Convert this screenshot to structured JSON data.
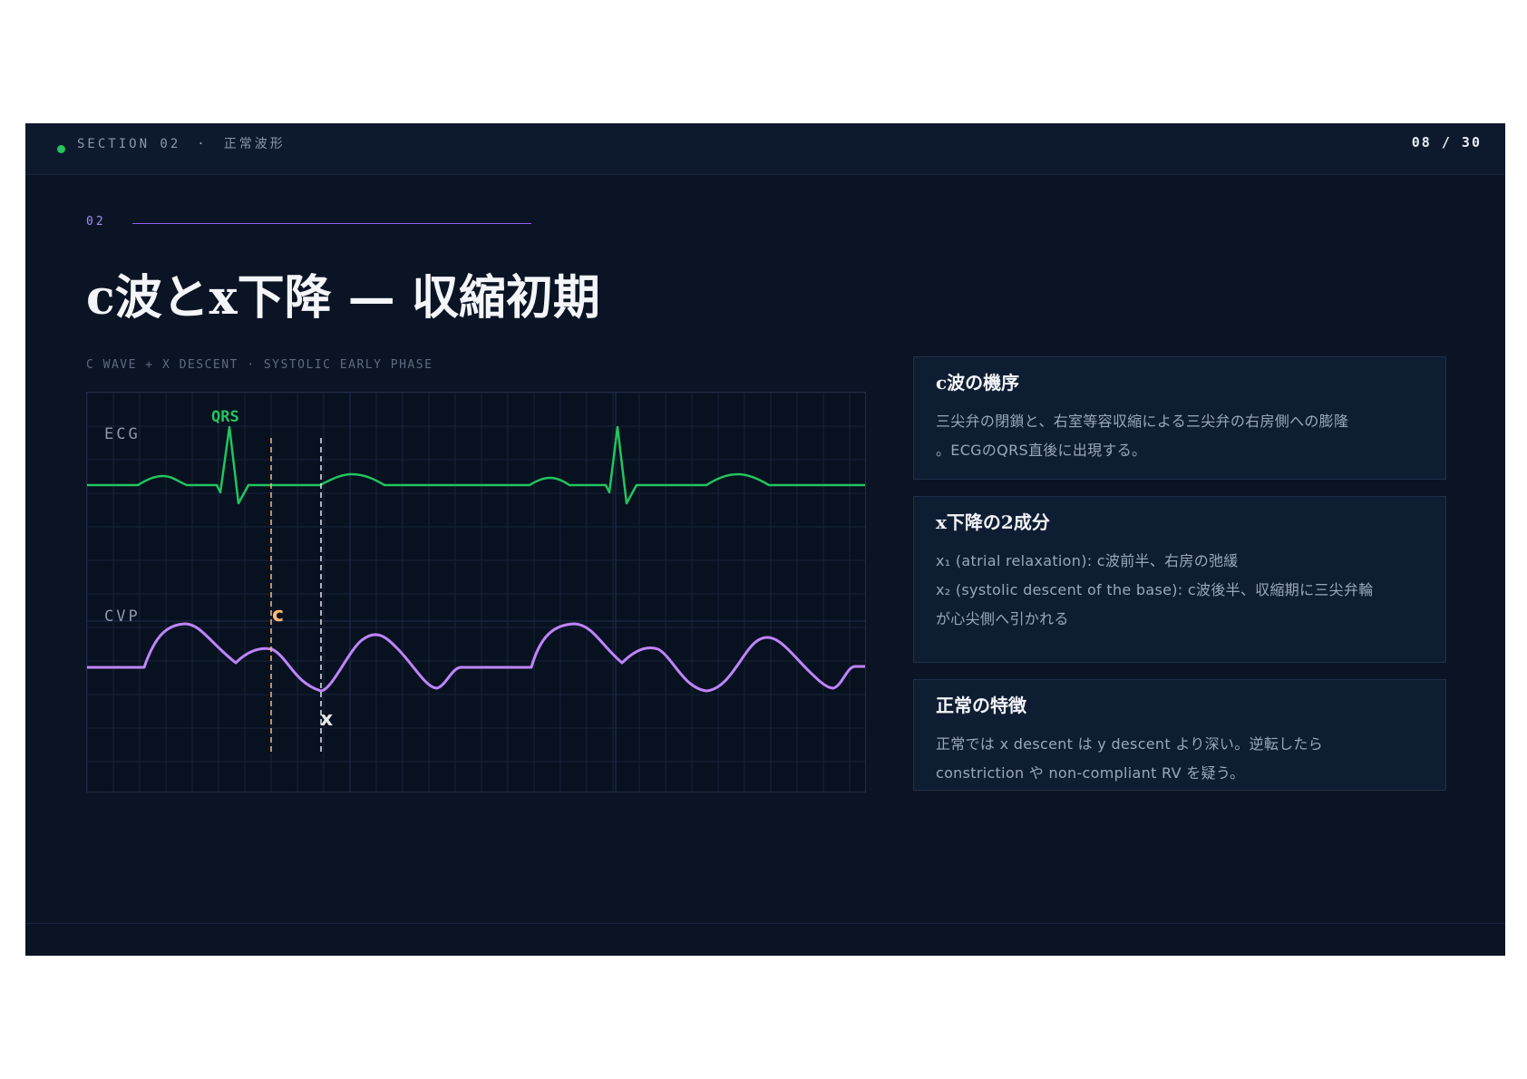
{
  "header": {
    "section": "SECTION 02",
    "separator": "·",
    "section_jp": "正常波形",
    "page": "08 / 30"
  },
  "eyebrow": {
    "number": "02"
  },
  "title": "c波とx下降 — 収縮初期",
  "subtitle": "C WAVE + X DESCENT  ·  SYSTOLIC EARLY PHASE",
  "diagram": {
    "ecg_label": "ECG",
    "cvp_label": "CVP",
    "qrs_label": "QRS",
    "c_label": "c",
    "x_label": "x",
    "colors": {
      "ecg": "#22c55e",
      "cvp": "#c084fc",
      "c_marker": "#fdba74",
      "x_marker": "#e5e7eb",
      "grid": "#16223a"
    }
  },
  "cards": [
    {
      "title": "c波の機序",
      "lines": [
        "三尖弁の閉鎖と、右室等容収縮による三尖弁の右房側への膨隆",
        "。ECGのQRS直後に出現する。"
      ]
    },
    {
      "title": "x下降の2成分",
      "lines": [
        "x₁ (atrial relaxation): c波前半、右房の弛緩",
        "x₂ (systolic descent of the base): c波後半、収縮期に三尖弁輪",
        "が心尖側へ引かれる"
      ]
    },
    {
      "title": "正常の特徴",
      "lines": [
        "正常では x descent は y descent より深い。逆転したら",
        "constriction や non-compliant RV を疑う。"
      ]
    }
  ]
}
